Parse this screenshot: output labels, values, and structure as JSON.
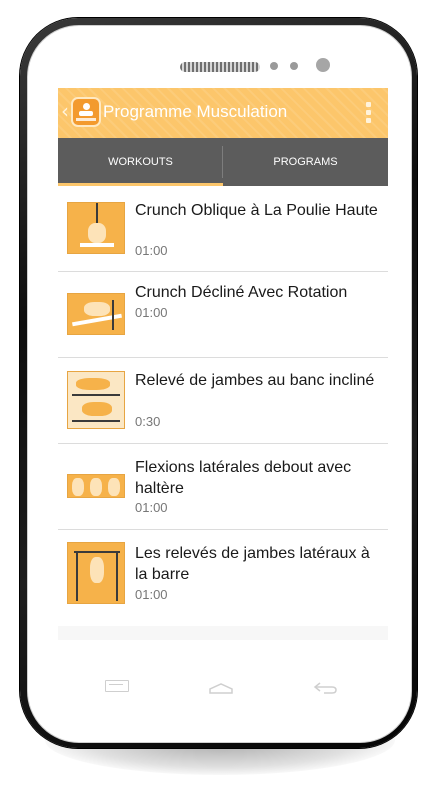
{
  "app": {
    "title": "Programme Musculation",
    "back_glyph": "‹",
    "logo_icon": "app-logo-icon",
    "overflow_icon": "overflow-menu-icon"
  },
  "tabs": [
    {
      "label": "WORKOUTS",
      "selected": true
    },
    {
      "label": "PROGRAMS",
      "selected": false
    }
  ],
  "workouts": [
    {
      "title": "Crunch Oblique à La Poulie Haute",
      "duration": "01:00"
    },
    {
      "title": "Crunch Décliné Avec Rotation",
      "duration": "01:00"
    },
    {
      "title": "Relevé de jambes au banc incliné",
      "duration": "0:30"
    },
    {
      "title": "Flexions latérales debout avec haltère",
      "duration": "01:00"
    },
    {
      "title": "Les relevés de jambes latéraux à la barre",
      "duration": "01:00"
    }
  ],
  "nav": {
    "recent_icon": "recent-apps-icon",
    "home_icon": "home-icon",
    "back_icon": "back-icon"
  },
  "colors": {
    "action_bar": "#fcc66b",
    "tab_bar": "#5c5c5c",
    "tab_indicator": "#fcc66b"
  }
}
